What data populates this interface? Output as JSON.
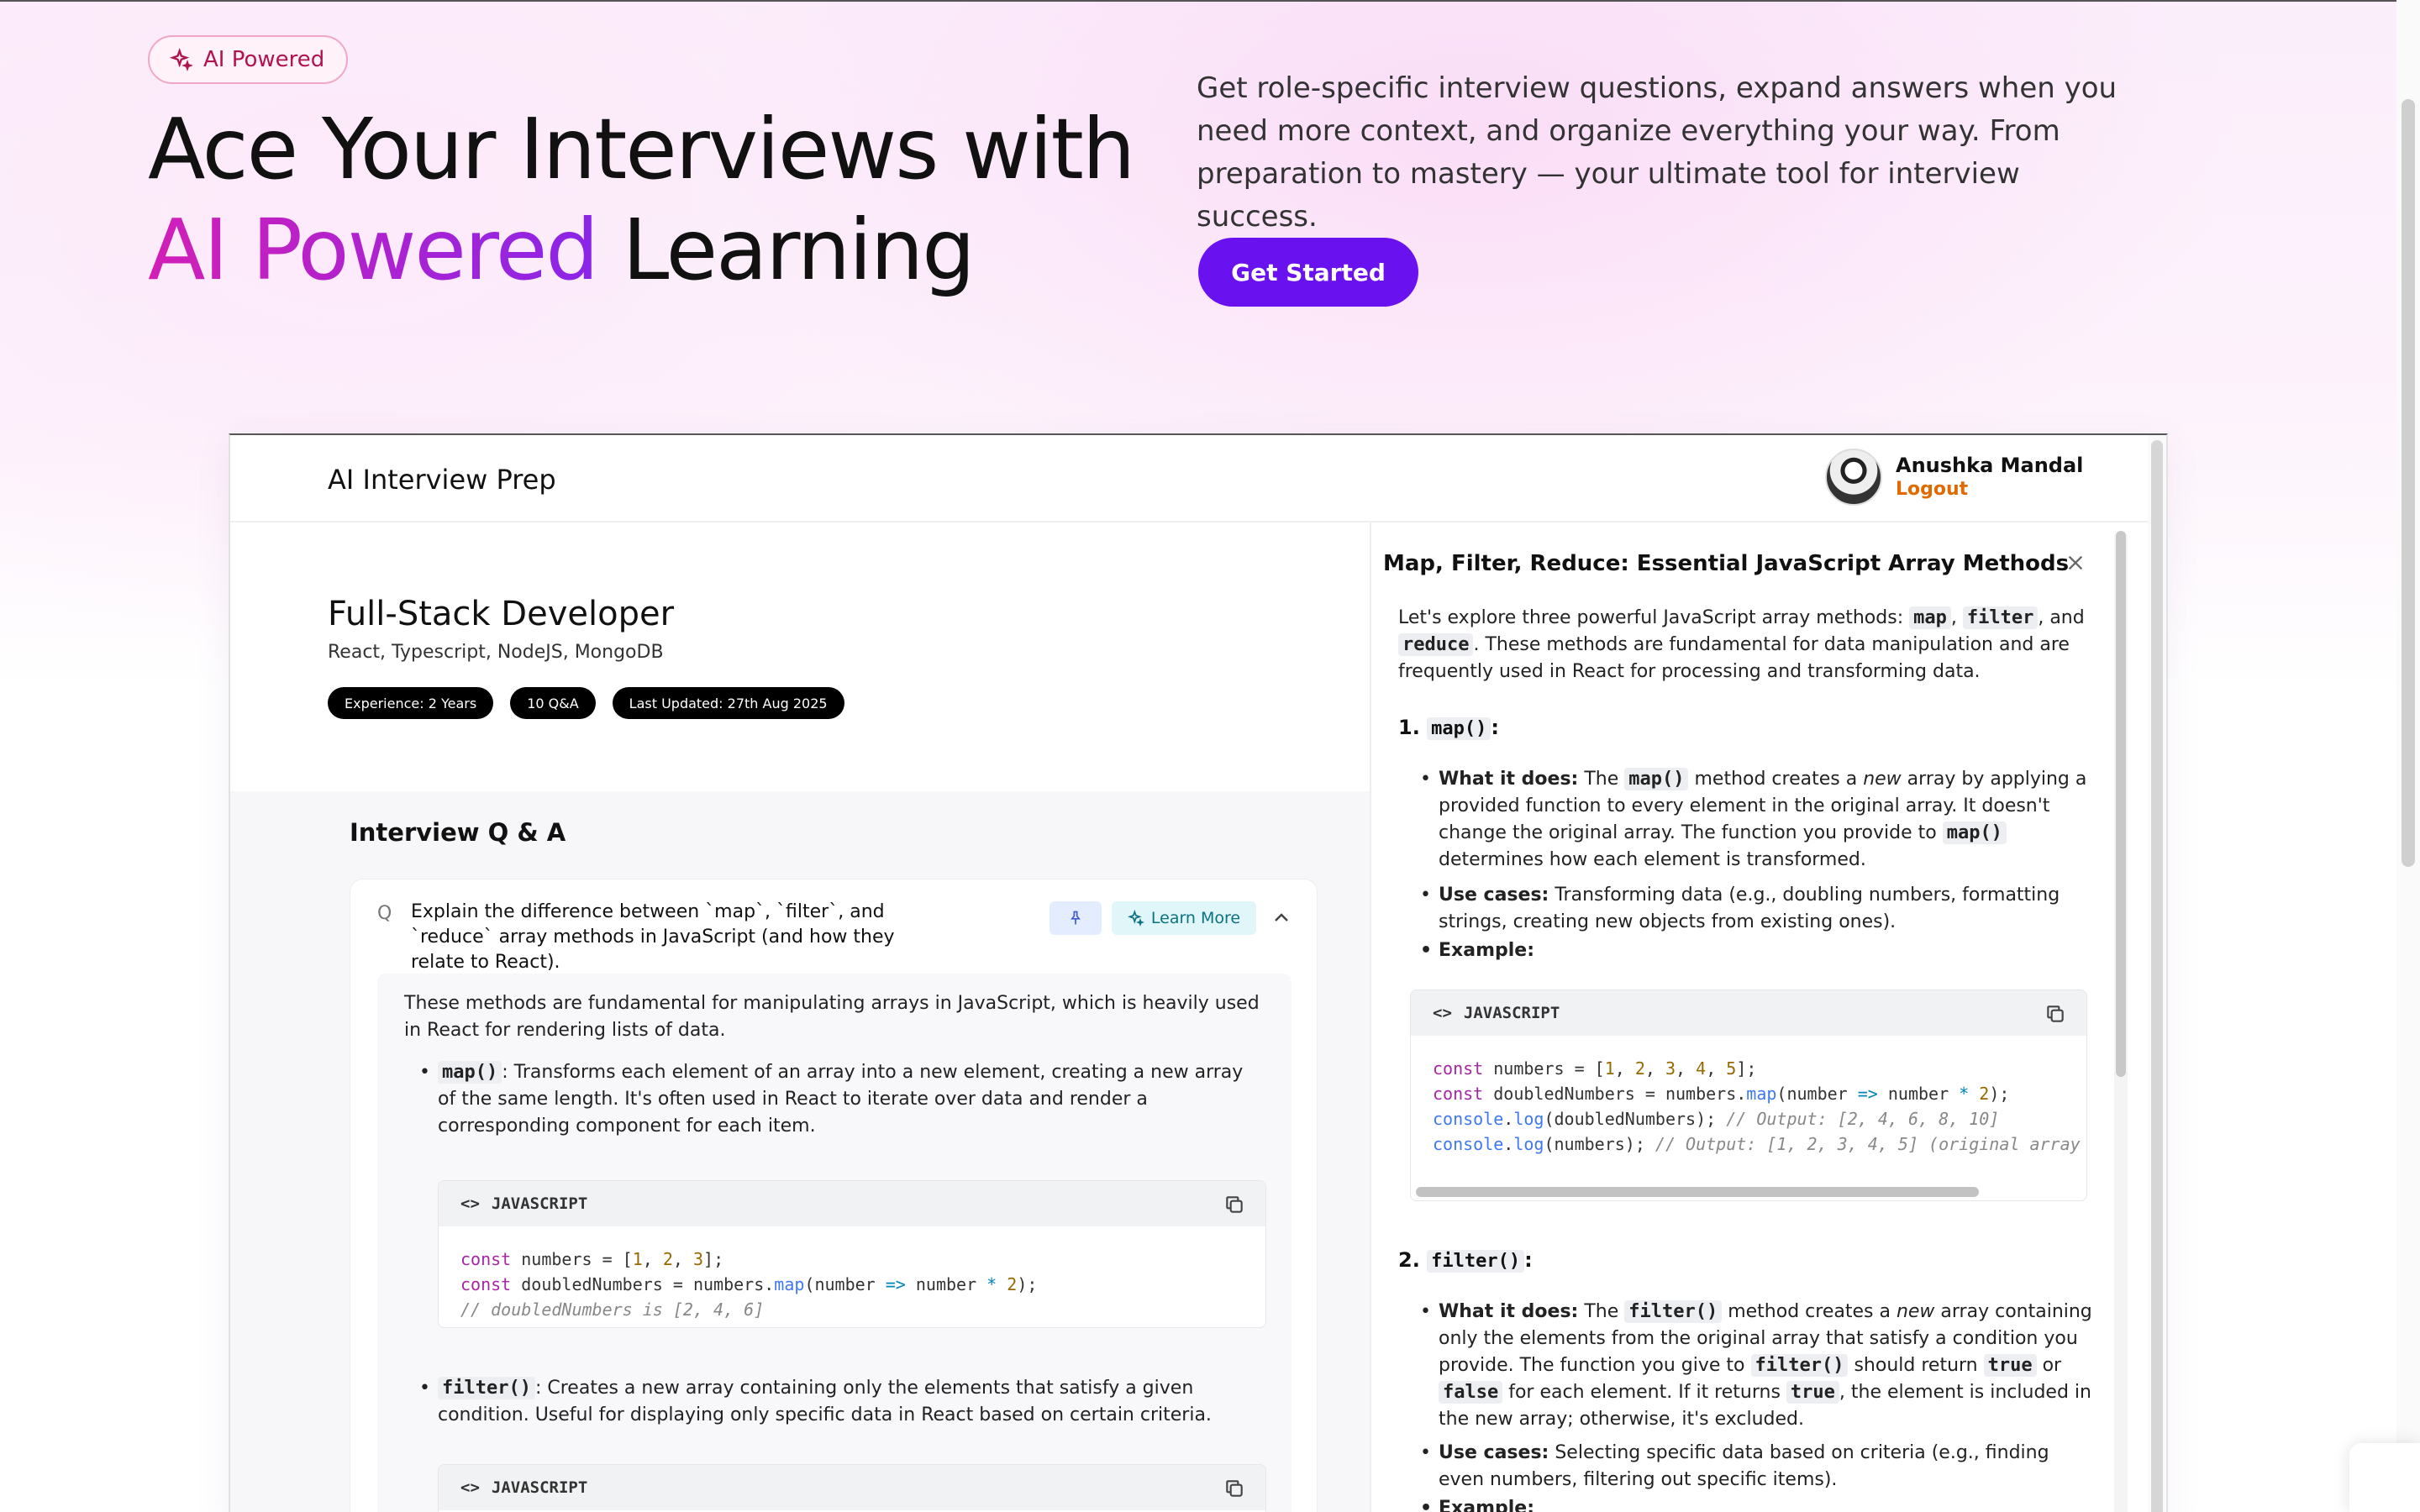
{
  "hero": {
    "badge": "AI Powered",
    "title_line1": "Ace Your Interviews with",
    "title_highlight": "AI Powered",
    "title_line2_rest": " Learning",
    "description": "Get role-specific interview questions, expand answers when you need more context, and organize everything your way. From preparation to mastery — your ultimate tool for interview success.",
    "cta": "Get Started"
  },
  "colors": {
    "accent": "#6a11f0",
    "highlight_start": "#d21fb7",
    "highlight_end": "#8a25e8",
    "logout": "#e06a00"
  },
  "app": {
    "logo": "AI Interview Prep",
    "user": {
      "name": "Anushka Mandal",
      "logout": "Logout"
    },
    "role": {
      "title": "Full-Stack Developer",
      "topics": "React, Typescript, NodeJS, MongoDB",
      "pills": [
        "Experience: 2 Years",
        "10 Q&A",
        "Last Updated: 27th Aug 2025"
      ]
    },
    "qa": {
      "heading": "Interview Q & A",
      "q_mark": "Q",
      "question": "Explain the difference between `map`, `filter`, and `reduce` array methods in JavaScript (and how they relate to React).",
      "learn_more": "Learn More",
      "answer_intro": "These methods are fundamental for manipulating arrays in JavaScript, which is heavily used in React for rendering lists of data.",
      "item1_code": "map()",
      "item1_text": ": Transforms each element of an array into a new element, creating a new array of the same length. It's often used in React to iterate over data and render a corresponding component for each item.",
      "item2_code": "filter()",
      "item2_text": ": Creates a new array containing only the elements that satisfy a given condition. Useful for displaying only specific data in React based on certain criteria.",
      "code_lang": "JAVASCRIPT"
    },
    "drawer": {
      "title": "Map, Filter, Reduce: Essential JavaScript Array Methods",
      "intro_a": "Let's explore three powerful JavaScript array methods: ",
      "intro_map": "map",
      "intro_sep": ", ",
      "intro_filter": "filter",
      "intro_and": ", and ",
      "intro_reduce": "reduce",
      "intro_b": ". These methods are fundamental for data manipulation and are frequently used in React for processing and transforming data.",
      "s1_num": "1. ",
      "s1_code": "map()",
      "s1_colon": ":",
      "s1_what_label": "What it does:",
      "s1_what_a": " The ",
      "s1_what_code": "map()",
      "s1_what_b": " method creates a ",
      "s1_what_new": "new",
      "s1_what_c": " array by applying a provided function to every element in the original array. It doesn't change the original array. The function you provide to ",
      "s1_what_code2": "map()",
      "s1_what_d": " determines how each element is transformed.",
      "s1_use_label": "Use cases:",
      "s1_use": " Transforming data (e.g., doubling numbers, formatting strings, creating new objects from existing ones).",
      "s1_example": "Example:",
      "s2_num": "2. ",
      "s2_code": "filter()",
      "s2_colon": ":",
      "s2_what_label": "What it does:",
      "s2_what_a": " The ",
      "s2_what_code": "filter()",
      "s2_what_b": " method creates a ",
      "s2_what_new": "new",
      "s2_what_c": " array containing only the elements from the original array that satisfy a condition you provide. The function you give to ",
      "s2_what_code2": "filter()",
      "s2_what_d": " should return ",
      "s2_true": "true",
      "s2_or": " or ",
      "s2_false": "false",
      "s2_what_e": " for each element. If it returns ",
      "s2_true2": "true",
      "s2_what_f": ", the element is included in the new array; otherwise, it's excluded.",
      "s2_use_label": "Use cases:",
      "s2_use": " Selecting specific data based on criteria (e.g., finding even numbers, filtering out specific items).",
      "s2_example": "Example:"
    }
  }
}
